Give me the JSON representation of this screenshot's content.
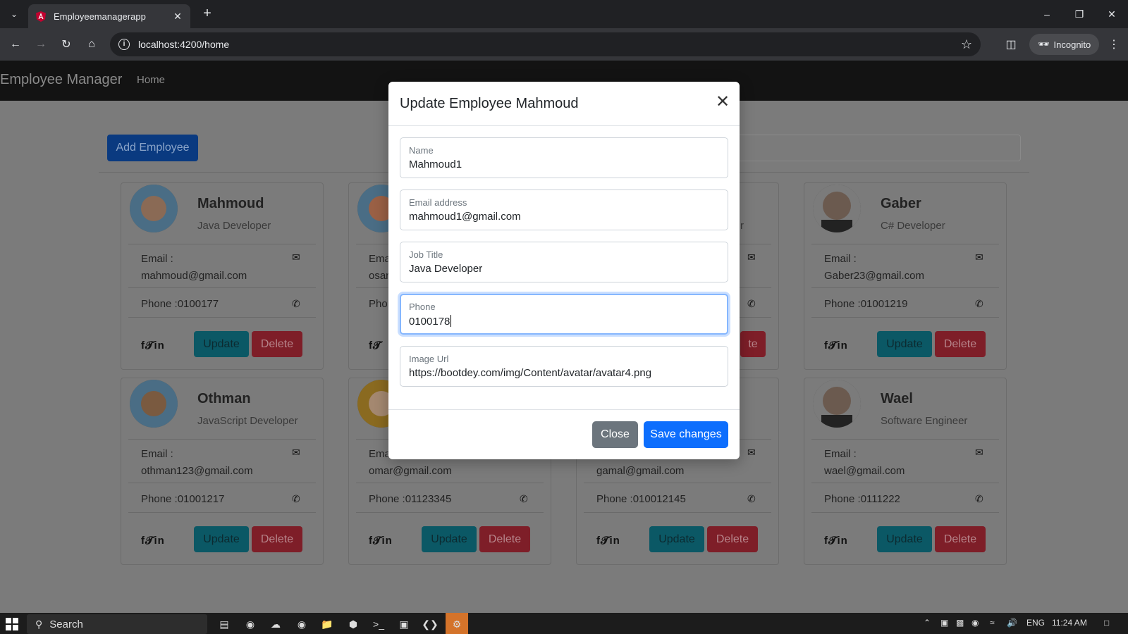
{
  "browser": {
    "tab_title": "Employeemanagerapp",
    "url": "localhost:4200/home",
    "incognito_label": "Incognito"
  },
  "navbar": {
    "brand": "Employee Manager",
    "home": "Home"
  },
  "toolbar": {
    "add_employee": "Add Employee"
  },
  "cards": [
    {
      "name": "Mahmoud",
      "job": "Java Developer",
      "email_label": "Email :",
      "email": "mahmoud@gmail.com",
      "phone": "Phone :0100177"
    },
    {
      "name": "",
      "job": "",
      "email_label": "Ema",
      "email": "osan",
      "phone": "Pho"
    },
    {
      "name": "",
      "job": "r",
      "email_label": "",
      "email": "",
      "phone": ""
    },
    {
      "name": "Gaber",
      "job": "C# Developer",
      "email_label": "Email :",
      "email": "Gaber23@gmail.com",
      "phone": "Phone :01001219"
    },
    {
      "name": "Othman",
      "job": "JavaScript Developer",
      "email_label": "Email :",
      "email": "othman123@gmail.com",
      "phone": "Phone :01001217"
    },
    {
      "name": "",
      "job": "",
      "email_label": "Ema",
      "email": "omar@gmail.com",
      "phone": "Phone :01123345"
    },
    {
      "name": "",
      "job": "",
      "email_label": "",
      "email": "gamal@gmail.com",
      "phone": "Phone :010012145"
    },
    {
      "name": "Wael",
      "job": "Software Engineer",
      "email_label": "Email :",
      "email": "wael@gmail.com",
      "phone": "Phone :0111222"
    }
  ],
  "card_buttons": {
    "update": "Update",
    "delete": "Delete",
    "delete_partial": "te"
  },
  "modal": {
    "title": "Update Employee Mahmoud",
    "fields": [
      {
        "label": "Name",
        "value": "Mahmoud1"
      },
      {
        "label": "Email address",
        "value": "mahmoud1@gmail.com"
      },
      {
        "label": "Job Title",
        "value": "Java Developer"
      },
      {
        "label": "Phone",
        "value": "0100178"
      },
      {
        "label": "Image Url",
        "value": "https://bootdey.com/img/Content/avatar/avatar4.png"
      }
    ],
    "close_label": "Close",
    "save_label": "Save changes"
  },
  "taskbar": {
    "search_placeholder": "Search",
    "language": "ENG",
    "time": "11:24 AM"
  },
  "colors": {
    "primary": "#0d6efd",
    "secondary": "#6c757d",
    "info_dimmed": "#0b5865",
    "danger_dimmed": "#7e1e28",
    "focus_ring": "#86b7fe"
  }
}
